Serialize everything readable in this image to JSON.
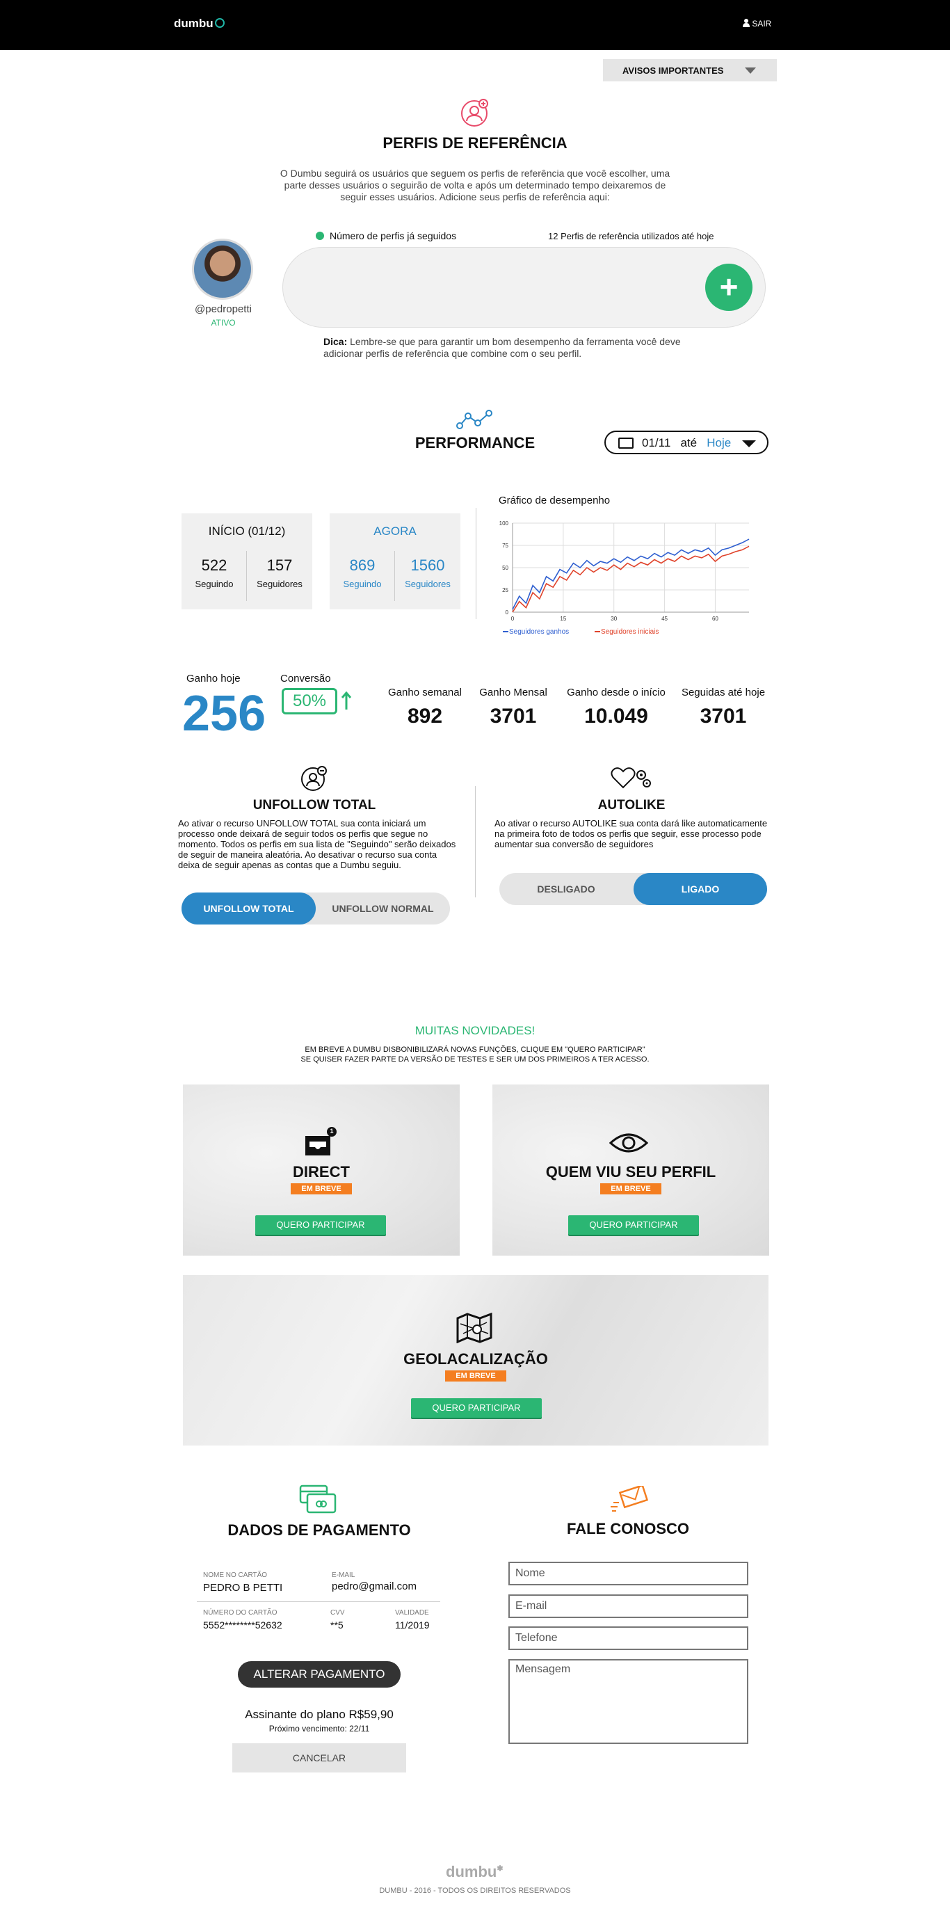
{
  "header": {
    "logo": "dumbu",
    "logout_label": "SAIR"
  },
  "avisos": {
    "label": "AVISOS IMPORTANTES"
  },
  "perfis": {
    "title": "PERFIS DE REFERÊNCIA",
    "description_lines": [
      "O Dumbu seguirá os usuários que seguem os perfis de referência que você escolher, uma",
      "parte desses usuários o seguirão de volta e após um determinado tempo deixaremos de",
      "seguir esses usuários.  Adicione seus perfis de referência aqui:"
    ],
    "username": "@pedropetti",
    "status": "ATIVO",
    "followed_legend": "Número de perfis já seguidos",
    "used_count_text": "12 Perfis de referência utilizados até hoje",
    "add_label": "+",
    "tip_label": "Dica:",
    "tip_lines": [
      "Lembre-se que para garantir um bom desempenho da ferramenta você deve",
      "adicionar perfis de referência que combine com o seu perfil."
    ]
  },
  "performance": {
    "title": "PERFORMANCE",
    "date_from": "01/11",
    "date_sep": "até",
    "date_to": "Hoje",
    "inicio": {
      "title": "INÍCIO (01/12)",
      "seguindo": "522",
      "seguidores": "157",
      "seguindo_label": "Seguindo",
      "seguidores_label": "Seguidores"
    },
    "agora": {
      "title": "AGORA",
      "seguindo": "869",
      "seguidores": "1560",
      "seguindo_label": "Seguindo",
      "seguidores_label": "Seguidores"
    },
    "ganho_hoje_label": "Ganho hoje",
    "ganho_hoje": "256",
    "conversao_label": "Conversão",
    "conversao": "50%",
    "metrics": [
      {
        "label": "Ganho semanal",
        "value": "892"
      },
      {
        "label": "Ganho Mensal",
        "value": "3701"
      },
      {
        "label": "Ganho desde o início",
        "value": "10.049"
      },
      {
        "label": "Seguidas até hoje",
        "value": "3701"
      }
    ]
  },
  "chart_data": {
    "type": "line",
    "title": "Gráfico de desempenho",
    "xlim": [
      0,
      70
    ],
    "ylim": [
      0,
      100
    ],
    "x_ticks": [
      "0",
      "15",
      "30",
      "45",
      "60"
    ],
    "y_ticks": [
      "0",
      "25",
      "50",
      "75",
      "100"
    ],
    "grid": true,
    "legend_placement": "bottom",
    "series": [
      {
        "name": "Seguidores ganhos",
        "color": "#2f5fd0",
        "x": [
          0,
          2,
          4,
          6,
          8,
          10,
          12,
          14,
          16,
          18,
          20,
          22,
          24,
          26,
          28,
          30,
          32,
          34,
          36,
          38,
          40,
          42,
          44,
          46,
          48,
          50,
          52,
          54,
          56,
          58,
          60,
          62,
          64,
          66,
          68,
          70
        ],
        "y": [
          3,
          18,
          10,
          30,
          22,
          40,
          35,
          48,
          44,
          55,
          50,
          58,
          52,
          57,
          55,
          60,
          56,
          62,
          58,
          63,
          60,
          66,
          62,
          67,
          64,
          70,
          66,
          70,
          68,
          72,
          64,
          70,
          72,
          75,
          78,
          82
        ]
      },
      {
        "name": "Seguidores iniciais",
        "color": "#e0432b",
        "x": [
          0,
          2,
          4,
          6,
          8,
          10,
          12,
          14,
          16,
          18,
          20,
          22,
          24,
          26,
          28,
          30,
          32,
          34,
          36,
          38,
          40,
          42,
          44,
          46,
          48,
          50,
          52,
          54,
          56,
          58,
          60,
          62,
          64,
          66,
          68,
          70
        ],
        "y": [
          0,
          12,
          5,
          22,
          15,
          32,
          28,
          40,
          36,
          47,
          42,
          50,
          45,
          50,
          47,
          53,
          48,
          55,
          51,
          56,
          53,
          59,
          55,
          60,
          57,
          63,
          59,
          63,
          61,
          65,
          57,
          63,
          65,
          68,
          70,
          74
        ]
      }
    ]
  },
  "unfollow": {
    "title": "UNFOLLOW TOTAL",
    "desc_lines": [
      "Ao ativar o recurso UNFOLLOW TOTAL sua conta iniciará um",
      "processo onde deixará de seguir todos os perfis que segue no",
      "momento. Todos os perfis em sua lista de \"Seguindo\" serão deixados",
      "de seguir de maneira aleatória. Ao desativar o recurso sua conta",
      "deixa de seguir apenas as contas que a Dumbu seguiu."
    ],
    "option_total": "UNFOLLOW TOTAL",
    "option_normal": "UNFOLLOW NORMAL"
  },
  "autolike": {
    "title": "AUTOLIKE",
    "desc_lines": [
      "Ao ativar o recurso AUTOLIKE sua conta dará like automaticamente",
      "na primeira foto de todos os perfis que seguir, esse processo pode",
      "aumentar sua conversão de seguidores"
    ],
    "option_off": "DESLIGADO",
    "option_on": "LIGADO"
  },
  "novidades": {
    "title": "MUITAS NOVIDADES!",
    "sub_lines": [
      "EM BREVE A DUMBU DISBONIBILIZARÁ NOVAS FUNÇÕES, CLIQUE EM \"QUERO PARTICIPAR\"",
      "SE QUISER FAZER PARTE DA VERSÃO DE TESTES E SER UM DOS PRIMEIROS A TER ACESSO."
    ],
    "badge": "EM BREVE",
    "button": "QUERO PARTICIPAR",
    "cards": [
      "DIRECT",
      "QUEM VIU SEU PERFIL",
      "GEOLACALIZAÇÃO"
    ],
    "direct_badge_count": "1"
  },
  "pagamento": {
    "title": "DADOS DE PAGAMENTO",
    "nome_label": "NOME NO CARTÃO",
    "nome": "PEDRO B PETTI",
    "email_label": "E-MAIL",
    "email": "pedro@gmail.com",
    "numero_label": "NÚMERO DO CARTÃO",
    "numero": "5552********52632",
    "cvv_label": "CVV",
    "cvv": "**5",
    "validade_label": "VALIDADE",
    "validade": "11/2019",
    "alterar": "ALTERAR PAGAMENTO",
    "plano": "Assinante do plano R$59,90",
    "vencimento": "Próximo vencimento: 22/11",
    "cancelar": "CANCELAR"
  },
  "contato": {
    "title": "FALE CONOSCO",
    "nome_ph": "Nome",
    "email_ph": "E-mail",
    "telefone_ph": "Telefone",
    "mensagem_ph": "Mensagem"
  },
  "footer": {
    "logo": "dumbu",
    "copyright": "DUMBU - 2016 - TODOS OS DIREITOS RESERVADOS"
  }
}
